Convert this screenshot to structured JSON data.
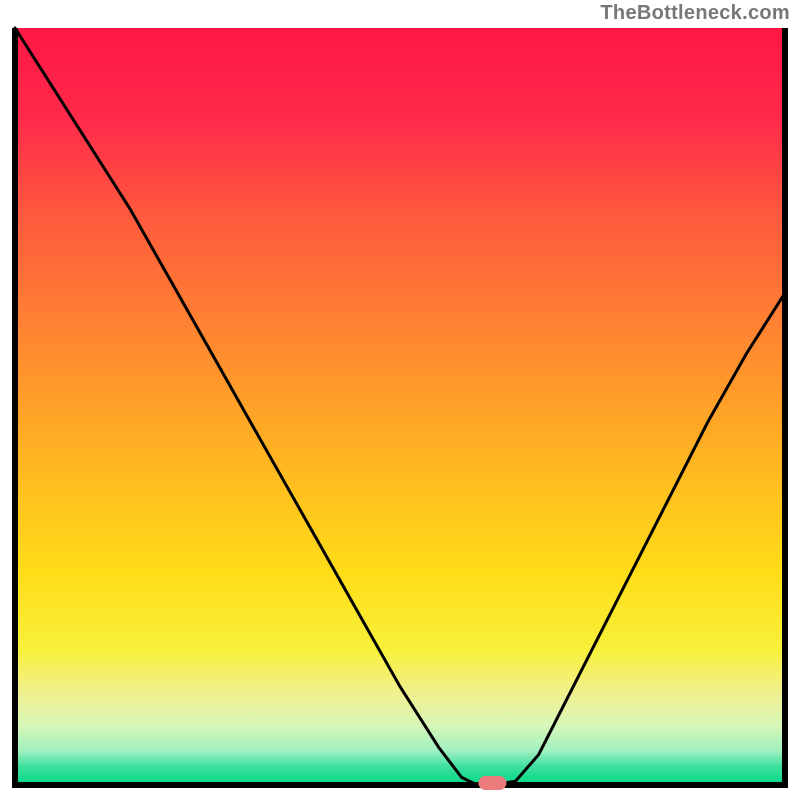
{
  "brand_watermark": "TheBottleneck.com",
  "chart_data": {
    "type": "line",
    "title": "",
    "xlabel": "",
    "ylabel": "",
    "xlim": [
      0,
      100
    ],
    "ylim": [
      0,
      100
    ],
    "x": [
      0,
      5,
      10,
      15,
      20,
      25,
      30,
      35,
      40,
      45,
      50,
      55,
      58,
      60,
      62,
      65,
      68,
      70,
      75,
      80,
      85,
      90,
      95,
      100
    ],
    "values": [
      100,
      92,
      84,
      76,
      67,
      58,
      49,
      40,
      31,
      22,
      13,
      5,
      1,
      0,
      0,
      0.5,
      4,
      8,
      18,
      28,
      38,
      48,
      57,
      65
    ],
    "marker_point": {
      "x": 62,
      "y": 0
    },
    "background_gradient": {
      "stops": [
        {
          "offset": 0.0,
          "color": "#ff1744"
        },
        {
          "offset": 0.12,
          "color": "#ff2a4a"
        },
        {
          "offset": 0.25,
          "color": "#ff5a3d"
        },
        {
          "offset": 0.42,
          "color": "#ff8a30"
        },
        {
          "offset": 0.58,
          "color": "#ffb820"
        },
        {
          "offset": 0.72,
          "color": "#ffdd18"
        },
        {
          "offset": 0.82,
          "color": "#f8f03a"
        },
        {
          "offset": 0.88,
          "color": "#f0f090"
        },
        {
          "offset": 0.92,
          "color": "#d8f8b8"
        },
        {
          "offset": 0.955,
          "color": "#a0f0c0"
        },
        {
          "offset": 0.975,
          "color": "#40e0a0"
        },
        {
          "offset": 1.0,
          "color": "#00d884"
        }
      ]
    },
    "axis_color": "#000000",
    "line_color": "#000000",
    "marker_color": "#ec7b7b"
  }
}
